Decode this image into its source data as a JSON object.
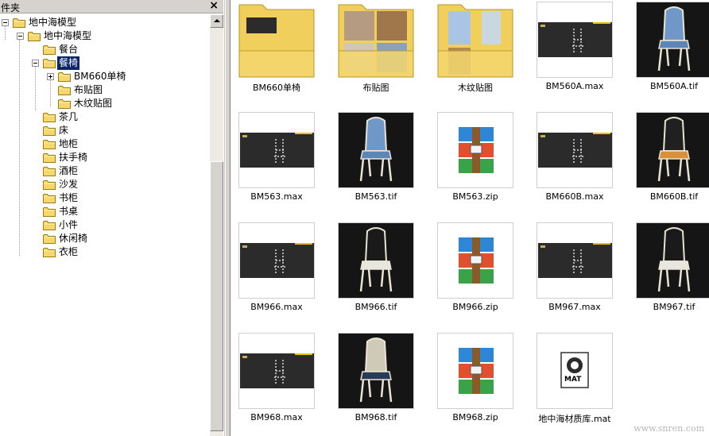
{
  "tree": {
    "header_title": "件夹",
    "close_label": "×",
    "nodes": [
      {
        "label": "地中海模型",
        "expander": "minus"
      },
      {
        "label": "地中海模型",
        "expander": "minus"
      },
      {
        "label": "餐台"
      },
      {
        "label": "餐椅",
        "expander": "minus",
        "selected": true
      },
      {
        "label": "BM660单椅",
        "expander": "plus"
      },
      {
        "label": "布贴图"
      },
      {
        "label": "木纹贴图"
      },
      {
        "label": "茶几"
      },
      {
        "label": "床"
      },
      {
        "label": "地柜"
      },
      {
        "label": "扶手椅"
      },
      {
        "label": "酒柜"
      },
      {
        "label": "沙发"
      },
      {
        "label": "书柜"
      },
      {
        "label": "书桌"
      },
      {
        "label": "小件"
      },
      {
        "label": "休闲椅"
      },
      {
        "label": "衣柜"
      }
    ]
  },
  "files": [
    {
      "name": "BM660单椅",
      "kind": "folder-dark"
    },
    {
      "name": "布贴图",
      "kind": "folder-fabric"
    },
    {
      "name": "木纹贴图",
      "kind": "folder-wood"
    },
    {
      "name": "BM560A.max",
      "kind": "max"
    },
    {
      "name": "BM560A.tif",
      "kind": "tif-blue"
    },
    {
      "name": "BM563.max",
      "kind": "max"
    },
    {
      "name": "BM563.tif",
      "kind": "tif-blue"
    },
    {
      "name": "BM563.zip",
      "kind": "zip"
    },
    {
      "name": "BM660B.max",
      "kind": "max"
    },
    {
      "name": "BM660B.tif",
      "kind": "tif-orange"
    },
    {
      "name": "BM966.max",
      "kind": "max"
    },
    {
      "name": "BM966.tif",
      "kind": "tif-white"
    },
    {
      "name": "BM966.zip",
      "kind": "zip"
    },
    {
      "name": "BM967.max",
      "kind": "max"
    },
    {
      "name": "BM967.tif",
      "kind": "tif-white"
    },
    {
      "name": "BM968.max",
      "kind": "max"
    },
    {
      "name": "BM968.tif",
      "kind": "tif-striped"
    },
    {
      "name": "BM968.zip",
      "kind": "zip"
    },
    {
      "name": "地中海材质库.mat",
      "kind": "mat"
    }
  ],
  "mat_icon_text": "MAT",
  "watermark": "www.snren.com",
  "colors": {
    "selection": "#0a246a",
    "folder": "#f5d76e",
    "max_band": "#2b2b2b",
    "max_accent": "#e8c200"
  }
}
